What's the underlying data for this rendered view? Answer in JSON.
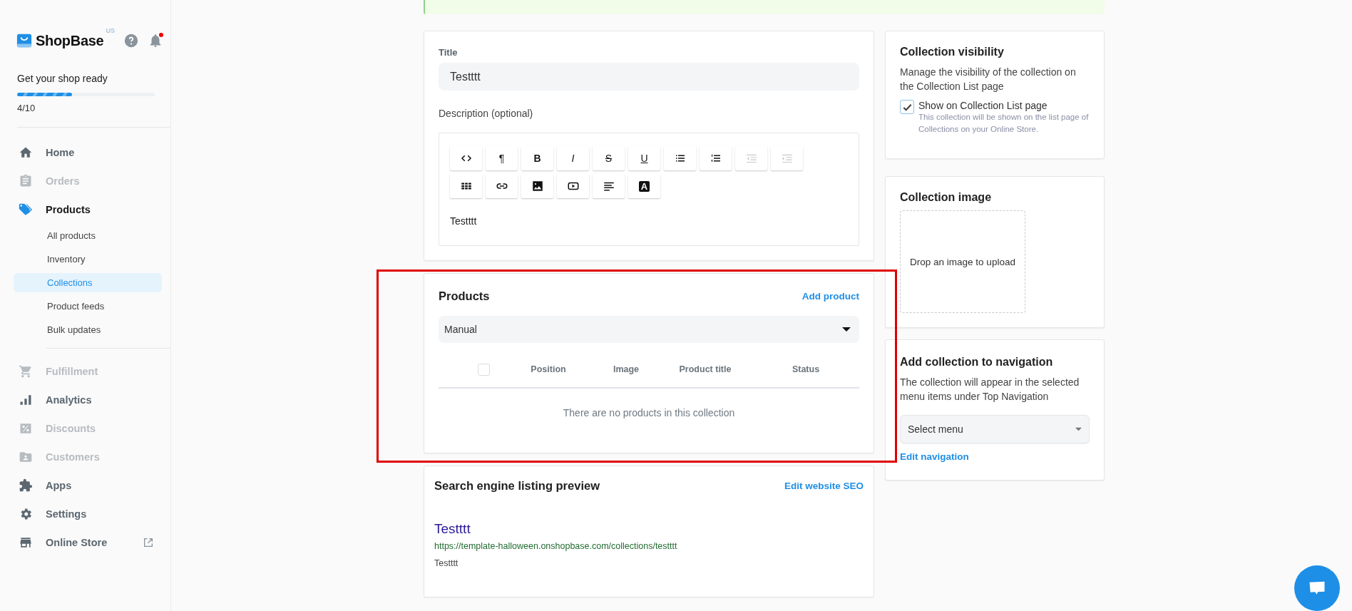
{
  "highlight": true,
  "sidebar": {
    "brand": "ShopBase",
    "region": "US",
    "notification": true,
    "setup": {
      "label": "Get your shop ready",
      "level": 0.4,
      "count": "4/10"
    },
    "nav": [
      {
        "label": "Home",
        "disabled": false,
        "active": false
      },
      {
        "label": "Orders",
        "disabled": true,
        "active": false
      },
      {
        "label": "Products",
        "disabled": false,
        "active": true,
        "children": [
          {
            "label": "All products",
            "selected": false
          },
          {
            "label": "Inventory",
            "selected": false
          },
          {
            "label": "Collections",
            "selected": true
          },
          {
            "label": "Product feeds",
            "selected": false
          },
          {
            "label": "Bulk updates",
            "selected": false
          }
        ]
      },
      {
        "label": "Fulfillment",
        "disabled": true,
        "active": false
      },
      {
        "label": "Analytics",
        "disabled": false,
        "active": false
      },
      {
        "label": "Discounts",
        "disabled": true,
        "active": false
      },
      {
        "label": "Customers",
        "disabled": true,
        "active": false
      },
      {
        "label": "Apps",
        "disabled": false,
        "active": false
      },
      {
        "label": "Settings",
        "disabled": false,
        "active": false
      },
      {
        "label": "Online Store",
        "disabled": false,
        "active": false,
        "external": true
      }
    ]
  },
  "title_card": {
    "label": "Title",
    "value": "Testttt",
    "description_label": "Description (optional)",
    "toolbar": [
      {
        "kind": "icon",
        "disabled": false
      },
      {
        "kind": "glyph",
        "text": "¶",
        "disabled": false
      },
      {
        "kind": "glyph",
        "text": "B",
        "disabled": false
      },
      {
        "kind": "glyph",
        "text": "I",
        "disabled": false
      },
      {
        "kind": "glyph",
        "text": "S",
        "disabled": false
      },
      {
        "kind": "glyph",
        "text": "U",
        "disabled": false
      },
      {
        "kind": "icon",
        "disabled": false
      },
      {
        "kind": "icon",
        "disabled": false
      },
      {
        "kind": "icon",
        "disabled": true
      },
      {
        "kind": "icon",
        "disabled": true
      },
      {
        "kind": "icon",
        "disabled": false
      },
      {
        "kind": "icon",
        "disabled": false
      },
      {
        "kind": "icon",
        "disabled": false
      },
      {
        "kind": "icon",
        "disabled": false
      },
      {
        "kind": "icon",
        "disabled": false
      },
      {
        "kind": "glyph",
        "text": "A",
        "disabled": false
      }
    ],
    "content": "Testttt"
  },
  "products_card": {
    "title": "Products",
    "action": "Add product",
    "sort": "Manual",
    "select_all": false,
    "columns": [
      "Position",
      "Image",
      "Product title",
      "Status"
    ],
    "empty": "There are no products in this collection"
  },
  "seo_card": {
    "title": "Search engine listing preview",
    "action": "Edit website SEO",
    "preview": {
      "title": "Testttt",
      "url": "https://template-halloween.onshopbase.com/collections/testttt",
      "description": "Testttt"
    }
  },
  "visibility_card": {
    "title": "Collection visibility",
    "text": "Manage the visibility of the collection on the Collection List page",
    "checkbox": {
      "label": "Show on Collection List page",
      "checked": true,
      "help": "This collection will be shown on the list page of Collections on your Online Store."
    }
  },
  "image_card": {
    "title": "Collection image",
    "dropzone": "Drop an image to upload"
  },
  "navigation_card": {
    "title": "Add collection to navigation",
    "text": "The collection will appear in the selected menu items under Top Navigation",
    "select": "Select menu",
    "link": "Edit navigation"
  }
}
